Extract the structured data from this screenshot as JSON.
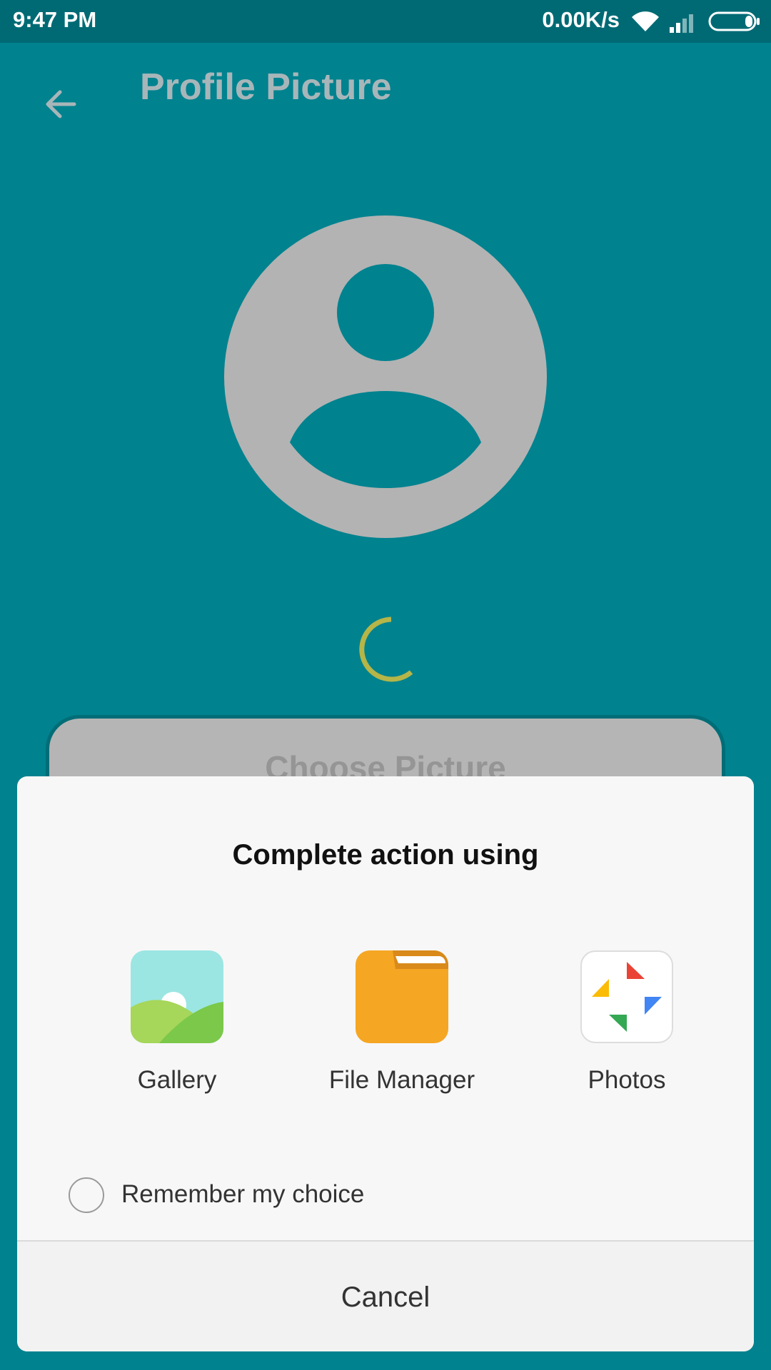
{
  "status_bar": {
    "time": "9:47 PM",
    "network_speed": "0.00K/s"
  },
  "toolbar": {
    "title": "Profile Picture"
  },
  "main": {
    "choose_button_label": "Choose Picture"
  },
  "dialog": {
    "title": "Complete action using",
    "apps": [
      {
        "label": "Gallery",
        "icon": "gallery-icon"
      },
      {
        "label": "File Manager",
        "icon": "file-manager-icon"
      },
      {
        "label": "Photos",
        "icon": "photos-icon"
      }
    ],
    "remember_label": "Remember my choice",
    "cancel_label": "Cancel"
  },
  "colors": {
    "background": "#00828F",
    "status_bar": "#006A74",
    "avatar": "#B3B3B3",
    "spinner": "#B5B548",
    "dialog": "#F7F7F7"
  }
}
